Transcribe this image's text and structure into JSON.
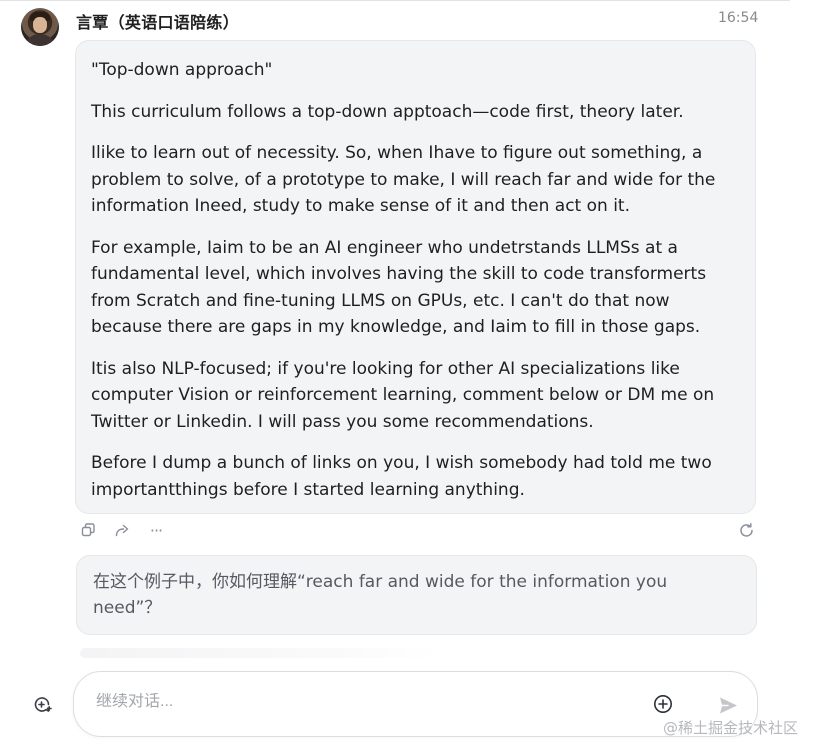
{
  "conversation": {
    "bot_name": "言覃（英语口语陪练）",
    "time": "16:54",
    "message": {
      "title": "\"Top-down approach\"",
      "paragraphs": [
        "This curriculum follows a top-down apptoach—code first, theory later.",
        "Ilike to learn out of necessity. So, when Ihave to figure out something, a problem to solve, of a prototype to make, I will reach far and wide for the information Ineed, study to make sense of it and then act on it.",
        "For example, Iaim to be an AI engineer who undetrstands LLMSs at a fundamental level, which involves having the skill to code transformerts from Scratch and fine-tuning LLMS on GPUs, etc. I can't do that now because there are gaps in my knowledge, and Iaim to fill in those gaps.",
        "Itis also NLP-focused; if you're looking for other AI specializations like computer Vision or reinforcement learning, comment below or DM me on Twitter or Linkedin. I will pass you some recommendations.",
        "Before I dump a bunch of links on you, I wish somebody had told me two importantthings before I started learning anything."
      ]
    },
    "message_actions": {
      "copy": "copy-icon",
      "share": "share-icon",
      "more": "···",
      "regenerate": "refresh-icon"
    },
    "suggestion": "在这个例子中，你如何理解“reach far and wide for the information you need”？"
  },
  "composer": {
    "placeholder": "继续对话...",
    "value": ""
  },
  "watermark": "@稀土掘金技术社区",
  "colors": {
    "bubble_bg": "#f3f4f6",
    "icon_gray": "#8a8f99",
    "send_gray": "#c4c6ca",
    "timestamp": "#8a8a8a"
  }
}
